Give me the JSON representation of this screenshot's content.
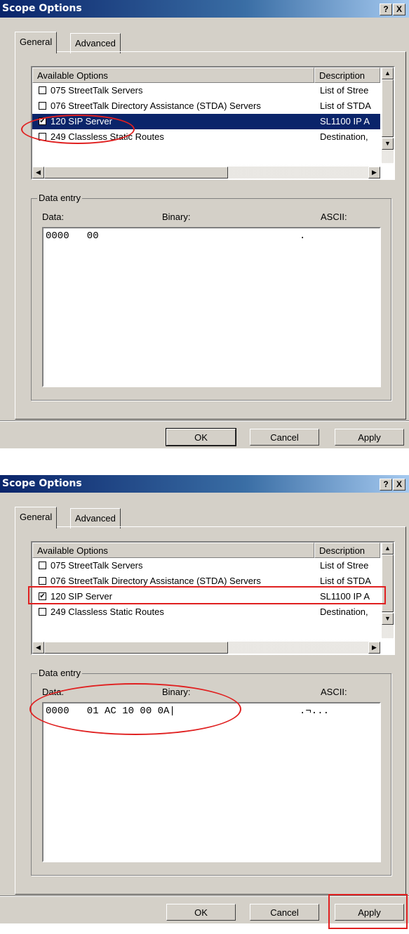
{
  "dialog1": {
    "title": "Scope Options",
    "help_glyph": "?",
    "close_glyph": "X",
    "tabs": [
      "General",
      "Advanced"
    ],
    "list_headers": {
      "name": "Available Options",
      "desc": "Description"
    },
    "options": [
      {
        "name": "075 StreetTalk Servers",
        "desc": "List of Stree",
        "checked": false
      },
      {
        "name": "076 StreetTalk Directory Assistance (STDA) Servers",
        "desc": "List of STDA",
        "checked": false
      },
      {
        "name": "120 SIP Server",
        "desc": "SL1100 IP A",
        "checked": true,
        "selected": true
      },
      {
        "name": "249 Classless Static Routes",
        "desc": "Destination,",
        "checked": false
      }
    ],
    "data_entry": {
      "group_label": "Data entry",
      "data_label": "Data:",
      "binary_label": "Binary:",
      "ascii_label": "ASCII:",
      "hex_line": "0000   00",
      "ascii_line": "."
    },
    "buttons": {
      "ok": "OK",
      "cancel": "Cancel",
      "apply": "Apply"
    }
  },
  "dialog2": {
    "title": "Scope Options",
    "help_glyph": "?",
    "close_glyph": "X",
    "tabs": [
      "General",
      "Advanced"
    ],
    "list_headers": {
      "name": "Available Options",
      "desc": "Description"
    },
    "options": [
      {
        "name": "075 StreetTalk Servers",
        "desc": "List of Stree",
        "checked": false
      },
      {
        "name": "076 StreetTalk Directory Assistance (STDA) Servers",
        "desc": "List of STDA",
        "checked": false
      },
      {
        "name": "120 SIP Server",
        "desc": "SL1100 IP A",
        "checked": true
      },
      {
        "name": "249 Classless Static Routes",
        "desc": "Destination,",
        "checked": false
      }
    ],
    "data_entry": {
      "group_label": "Data entry",
      "data_label": "Data:",
      "binary_label": "Binary:",
      "ascii_label": "ASCII:",
      "hex_line": "0000   01 AC 10 00 0A|",
      "ascii_line": ".¬..."
    },
    "buttons": {
      "ok": "OK",
      "cancel": "Cancel",
      "apply": "Apply"
    }
  },
  "annotation_color": "#e02020"
}
